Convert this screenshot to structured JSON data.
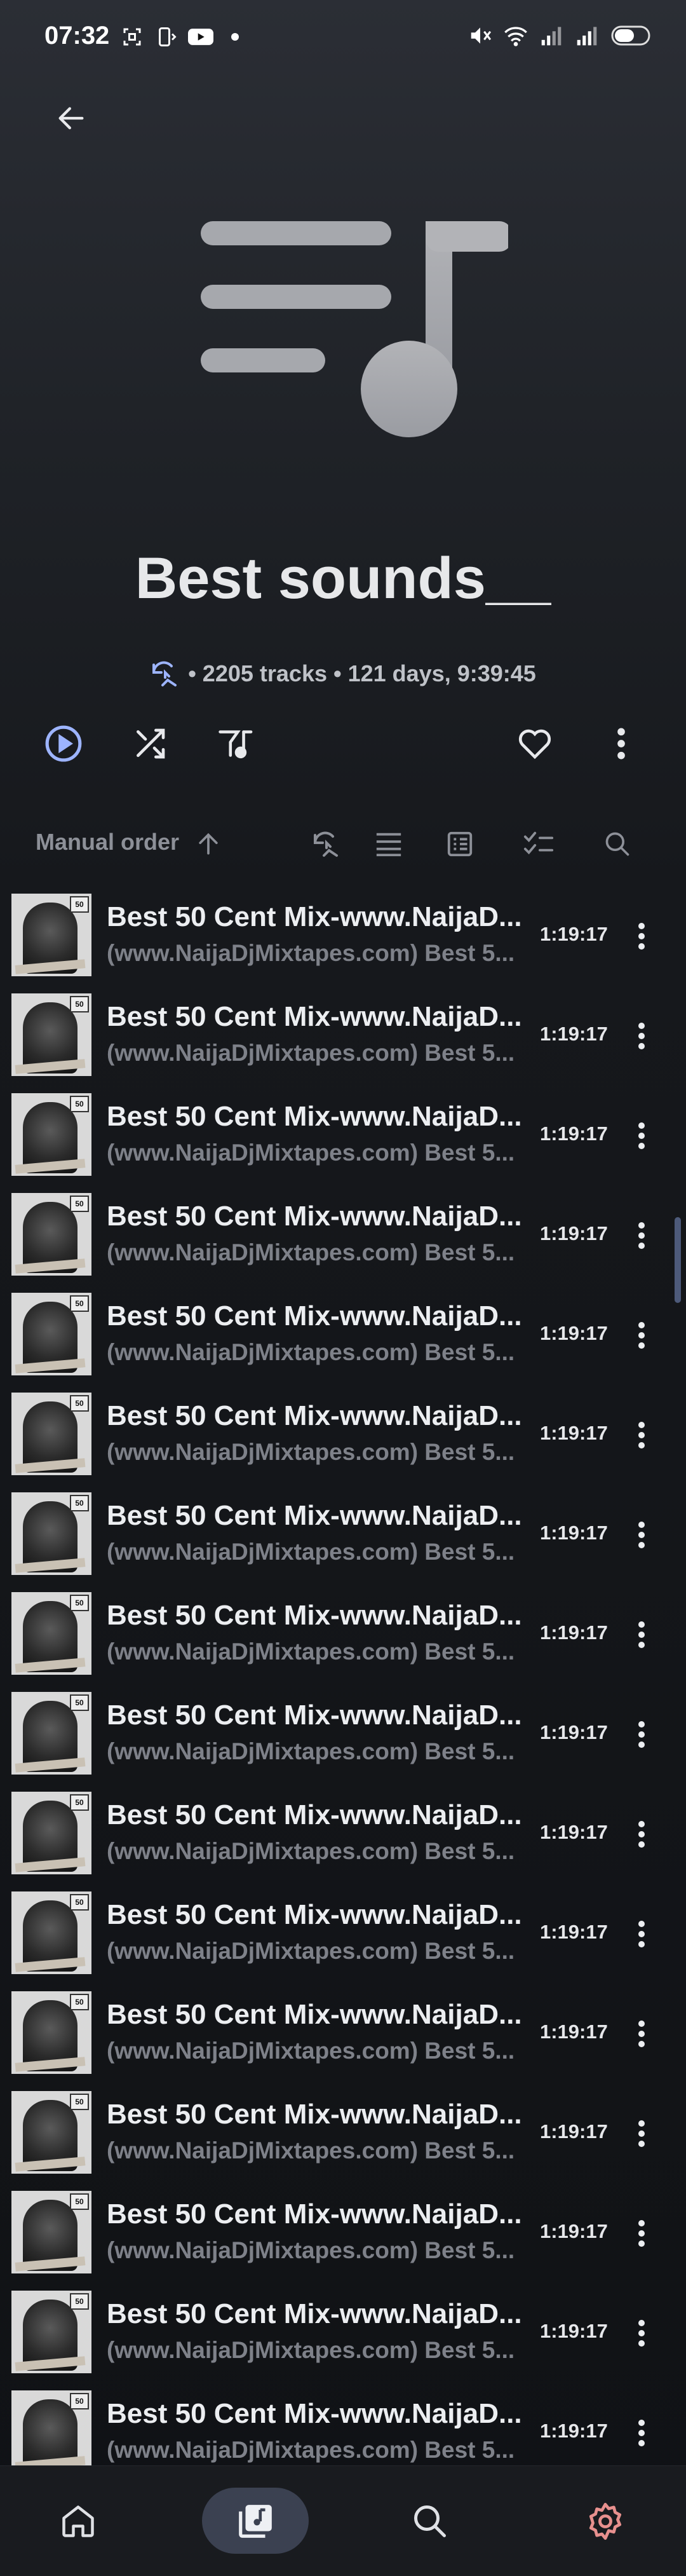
{
  "status_bar": {
    "time": "07:32",
    "left_icons": [
      "screenshot-icon",
      "cast-icon",
      "youtube-icon",
      "dot-icon"
    ],
    "right_icons": [
      "mute-icon",
      "wifi-icon",
      "signal-icon",
      "signal-icon",
      "battery-icon"
    ]
  },
  "playlist": {
    "title": "Best sounds__",
    "meta": "• 2205 tracks • 121 days, 9:39:45"
  },
  "actions": [
    "play-icon",
    "shuffle-icon",
    "equalizer-icon",
    "heart-icon",
    "more-vert-icon"
  ],
  "sort": {
    "label": "Manual order",
    "icons": [
      "recent-icon",
      "list-icon",
      "details-icon",
      "multi-select-icon",
      "search-icon"
    ]
  },
  "tracks": [
    {
      "title": "Best 50 Cent Mix-www.NaijaD...",
      "subtitle": "(www.NaijaDjMixtapes.com) Best 5...",
      "duration": "1:19:17"
    },
    {
      "title": "Best 50 Cent Mix-www.NaijaD...",
      "subtitle": "(www.NaijaDjMixtapes.com) Best 5...",
      "duration": "1:19:17"
    },
    {
      "title": "Best 50 Cent Mix-www.NaijaD...",
      "subtitle": "(www.NaijaDjMixtapes.com) Best 5...",
      "duration": "1:19:17"
    },
    {
      "title": "Best 50 Cent Mix-www.NaijaD...",
      "subtitle": "(www.NaijaDjMixtapes.com) Best 5...",
      "duration": "1:19:17"
    },
    {
      "title": "Best 50 Cent Mix-www.NaijaD...",
      "subtitle": "(www.NaijaDjMixtapes.com) Best 5...",
      "duration": "1:19:17"
    },
    {
      "title": "Best 50 Cent Mix-www.NaijaD...",
      "subtitle": "(www.NaijaDjMixtapes.com) Best 5...",
      "duration": "1:19:17"
    },
    {
      "title": "Best 50 Cent Mix-www.NaijaD...",
      "subtitle": "(www.NaijaDjMixtapes.com) Best 5...",
      "duration": "1:19:17"
    },
    {
      "title": "Best 50 Cent Mix-www.NaijaD...",
      "subtitle": "(www.NaijaDjMixtapes.com) Best 5...",
      "duration": "1:19:17"
    },
    {
      "title": "Best 50 Cent Mix-www.NaijaD...",
      "subtitle": "(www.NaijaDjMixtapes.com) Best 5...",
      "duration": "1:19:17"
    },
    {
      "title": "Best 50 Cent Mix-www.NaijaD...",
      "subtitle": "(www.NaijaDjMixtapes.com) Best 5...",
      "duration": "1:19:17"
    },
    {
      "title": "Best 50 Cent Mix-www.NaijaD...",
      "subtitle": "(www.NaijaDjMixtapes.com) Best 5...",
      "duration": "1:19:17"
    },
    {
      "title": "Best 50 Cent Mix-www.NaijaD...",
      "subtitle": "(www.NaijaDjMixtapes.com) Best 5...",
      "duration": "1:19:17"
    },
    {
      "title": "Best 50 Cent Mix-www.NaijaD...",
      "subtitle": "(www.NaijaDjMixtapes.com) Best 5...",
      "duration": "1:19:17"
    },
    {
      "title": "Best 50 Cent Mix-www.NaijaD...",
      "subtitle": "(www.NaijaDjMixtapes.com) Best 5...",
      "duration": "1:19:17"
    },
    {
      "title": "Best 50 Cent Mix-www.NaijaD...",
      "subtitle": "(www.NaijaDjMixtapes.com) Best 5...",
      "duration": "1:19:17"
    },
    {
      "title": "Best 50 Cent Mix-www.NaijaD...",
      "subtitle": "(www.NaijaDjMixtapes.com) Best 5...",
      "duration": "1:19:17"
    }
  ],
  "bottom_nav": [
    "home-icon",
    "library-icon",
    "search-icon",
    "settings-icon"
  ],
  "colors": {
    "accent": "#9db4ff",
    "settings": "#e7908e",
    "active_pill": "#3b4151"
  }
}
